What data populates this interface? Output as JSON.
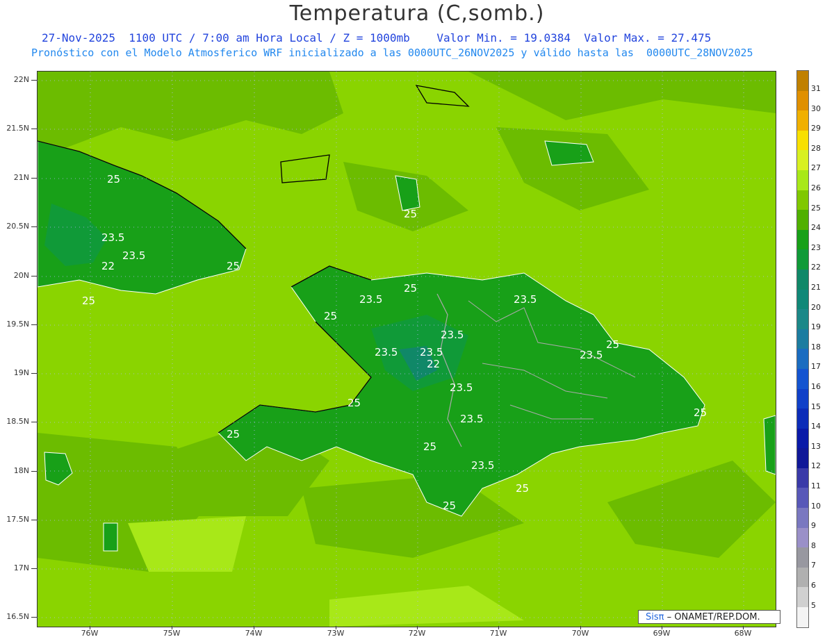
{
  "header": {
    "title": "Temperatura (C,somb.)",
    "line1": "27-Nov-2025  1100 UTC / 7:00 am Hora Local / Z = 1000mb    Valor Min. = 19.0384  Valor Max. = 27.475",
    "line2": "Pronóstico con el Modelo Atmosferico WRF inicializado a las 0000UTC_26NOV2025 y válido hasta las  0000UTC_28NOV2025"
  },
  "axes": {
    "lat_labels": [
      "22N",
      "21.5N",
      "21N",
      "20.5N",
      "20N",
      "19.5N",
      "19N",
      "18.5N",
      "18N",
      "17.5N",
      "17N",
      "16.5N"
    ],
    "lon_labels": [
      "76W",
      "75W",
      "74W",
      "73W",
      "72W",
      "71W",
      "70W",
      "69W",
      "68W"
    ]
  },
  "legend": {
    "labels": [
      "31",
      "30",
      "29",
      "28",
      "27",
      "26",
      "25",
      "24",
      "23",
      "22",
      "21",
      "20",
      "19",
      "18",
      "17",
      "16",
      "15",
      "14",
      "13",
      "12",
      "11",
      "10",
      "9",
      "8",
      "7",
      "6",
      "5"
    ],
    "colors": [
      "#c08000",
      "#e09000",
      "#f0b000",
      "#f8e000",
      "#d8f020",
      "#a8e818",
      "#80c800",
      "#50b000",
      "#18a018",
      "#109a38",
      "#108868",
      "#108878",
      "#1c8888",
      "#1c7ca0",
      "#1a6cc0",
      "#1454d0",
      "#1040c8",
      "#0c2cb8",
      "#0a1aa8",
      "#101898",
      "#3a3aa8",
      "#5858b8",
      "#7a78c0",
      "#9a90c8",
      "#9898a0",
      "#b0b0b0",
      "#d0d0d0",
      "#f4f4f4"
    ]
  },
  "contour_labels": [
    "25",
    "23.5",
    "22",
    "25",
    "25",
    "25",
    "23.5",
    "23.5",
    "25",
    "25",
    "23.5",
    "23.5",
    "22",
    "23.5",
    "25",
    "23.5",
    "23.5",
    "25",
    "23.5",
    "25",
    "25",
    "25",
    "23.5",
    "23.5",
    "25",
    "25"
  ],
  "footer": {
    "sis": "Sisπ",
    "org": " – ONAMET/REP.DOM."
  }
}
